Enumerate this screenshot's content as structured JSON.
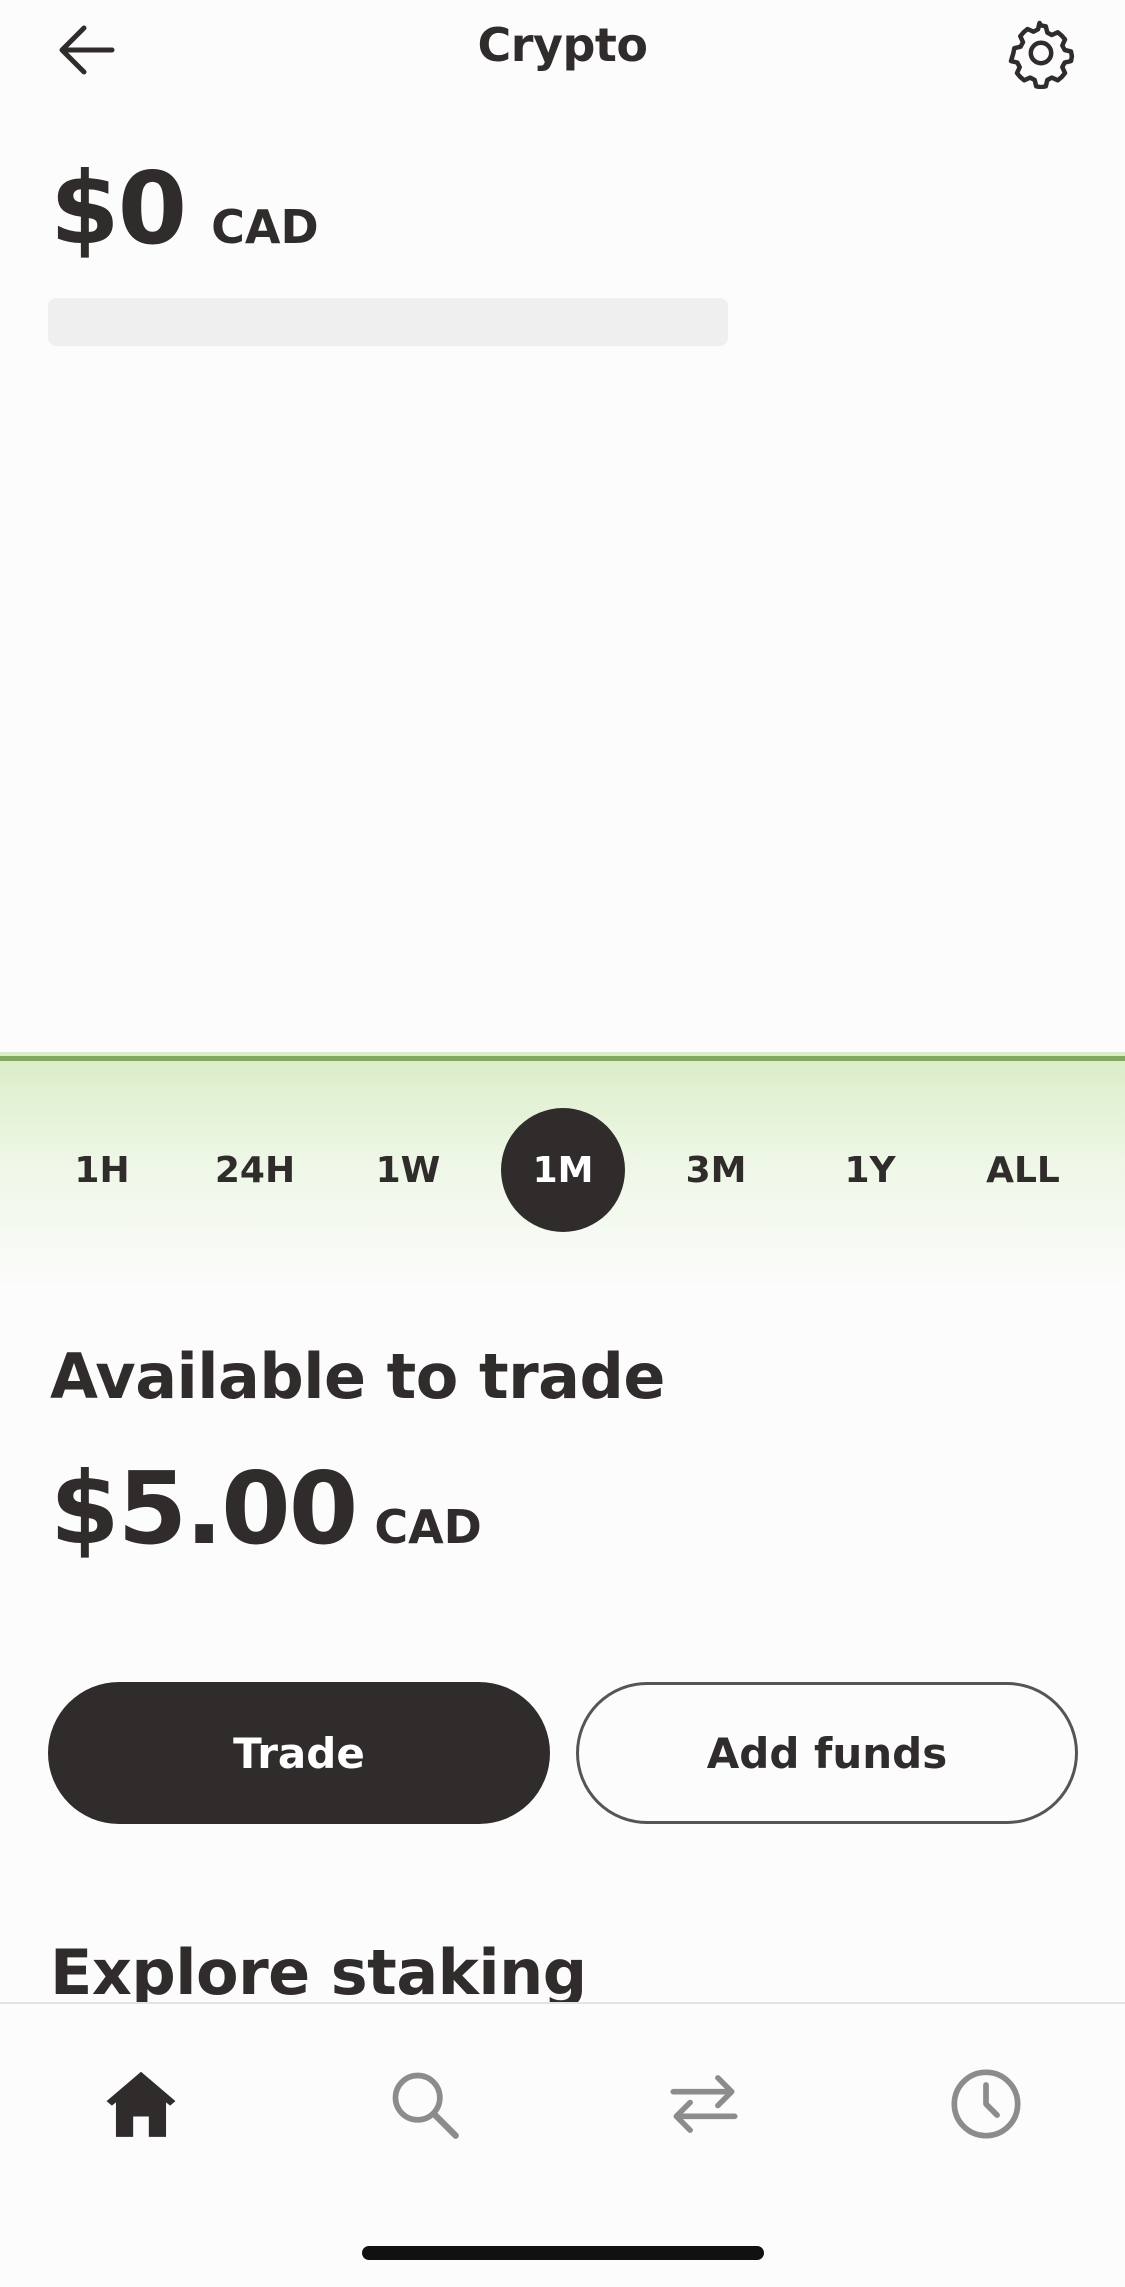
{
  "header": {
    "title": "Crypto",
    "back_icon": "arrow-left-icon",
    "settings_icon": "gear-icon"
  },
  "balance": {
    "amount": "$0",
    "currency": "CAD"
  },
  "chart": {
    "line_color": "#83a862"
  },
  "time_ranges": {
    "items": [
      "1H",
      "24H",
      "1W",
      "1M",
      "3M",
      "1Y",
      "ALL"
    ],
    "selected": "1M"
  },
  "available": {
    "label": "Available to trade",
    "amount": "$5.00",
    "currency": "CAD"
  },
  "actions": {
    "trade_label": "Trade",
    "add_funds_label": "Add funds"
  },
  "explore": {
    "title": "Explore staking"
  },
  "tab_bar": {
    "items": [
      {
        "icon": "home-icon",
        "active": true
      },
      {
        "icon": "search-icon",
        "active": false
      },
      {
        "icon": "transfer-icon",
        "active": false
      },
      {
        "icon": "clock-icon",
        "active": false
      }
    ]
  },
  "colors": {
    "text": "#2f2c2b",
    "accent_green": "#83a862",
    "inactive_icon": "#8c8c8c"
  }
}
